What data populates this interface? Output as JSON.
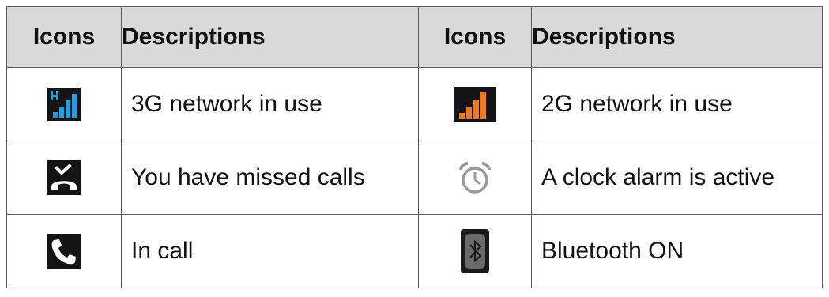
{
  "headers": {
    "icons_left": "Icons",
    "descriptions_left": "Descriptions",
    "icons_right": "Icons",
    "descriptions_right": "Descriptions"
  },
  "rows": [
    {
      "left_icon": "signal-3g-h-icon",
      "left_desc": "3G network in use",
      "right_icon": "signal-2g-orange-icon",
      "right_desc": "2G network in use"
    },
    {
      "left_icon": "missed-call-icon",
      "left_desc": "You have missed calls",
      "right_icon": "alarm-clock-icon",
      "right_desc": "A clock alarm is active"
    },
    {
      "left_icon": "in-call-phone-icon",
      "left_desc": "In call",
      "right_icon": "bluetooth-icon",
      "right_desc": "Bluetooth ON"
    }
  ],
  "colors": {
    "header_bg": "#d9d9d9",
    "border": "#5a5a5a",
    "signal_3g": "#1ea0e6",
    "signal_2g": "#f07818",
    "icon_dark_bg": "#141414"
  }
}
